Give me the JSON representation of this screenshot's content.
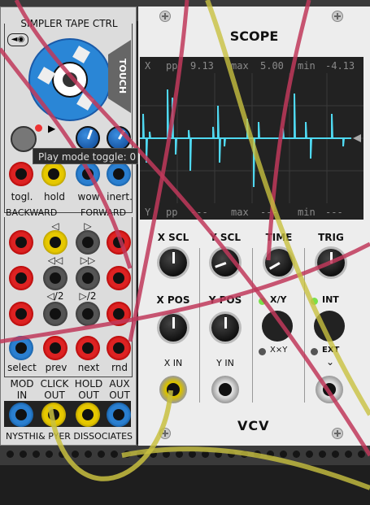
{
  "simpler": {
    "title": "SIMPLER TAPE CTRL",
    "touch_label": "TOUCH",
    "top_jack_labels": [
      "togl.",
      "hold",
      "wow",
      "inert."
    ],
    "backward_label": "BACKWARD",
    "forward_label": "FORWARD",
    "nav_symbols": {
      "back_play": "◁",
      "fwd_play": "▷",
      "back_fast": "◁◁",
      "fwd_fast": "▷▷",
      "back_half": "◁/2",
      "fwd_half": "▷/2"
    },
    "select_labels": [
      "select",
      "prev",
      "next",
      "rnd"
    ],
    "out_labels": [
      {
        "top": "MOD",
        "bottom": "IN"
      },
      {
        "top": "CLICK",
        "bottom": "OUT"
      },
      {
        "top": "HOLD",
        "bottom": "OUT"
      },
      {
        "top": "AUX",
        "bottom": "OUT"
      }
    ],
    "footer": "NYSTHI& PYER DISSOCIATES"
  },
  "tooltip": "Play mode toggle: 0",
  "scope": {
    "title": "SCOPE",
    "readout_x": {
      "axis": "X",
      "pp_label": "pp",
      "pp": "9.13",
      "max_label": "max",
      "max": "5.00",
      "min_label": "min",
      "min": "-4.13"
    },
    "readout_y": {
      "axis": "Y",
      "pp_label": "pp",
      "pp": "---",
      "max_label": "max",
      "max": "---",
      "min_label": "min",
      "min": "---"
    },
    "knob_labels": [
      "X SCL",
      "Y SCL",
      "TIME",
      "TRIG"
    ],
    "pos_labels": [
      "X POS",
      "Y POS"
    ],
    "xy_label": "X/Y",
    "xxy_label": "X×Y",
    "int_label": "INT",
    "ext_label": "EXT",
    "ext_arrow": "⌄",
    "xin_label": "X IN",
    "yin_label": "Y IN",
    "brand": "VCV"
  },
  "colors": {
    "trace": "#4fd8f0",
    "led_green": "#7be04a",
    "cable_red": "#c0385a",
    "cable_yellow": "#c8c040"
  }
}
